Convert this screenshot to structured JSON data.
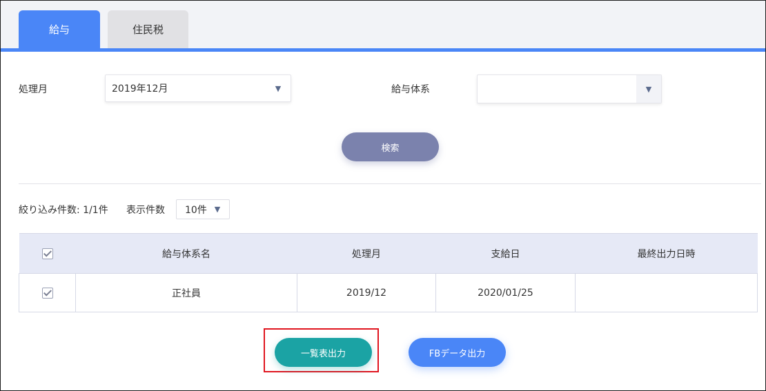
{
  "tabs": [
    {
      "label": "給与",
      "active": true
    },
    {
      "label": "住民税",
      "active": false
    }
  ],
  "filters": {
    "month_label": "処理月",
    "month_value": "2019年12月",
    "system_label": "給与体系",
    "system_value": ""
  },
  "search_label": "検索",
  "results": {
    "count_text": "絞り込み件数: 1/1件",
    "per_page_label": "表示件数",
    "per_page_value": "10件"
  },
  "table": {
    "headers": [
      "給与体系名",
      "処理月",
      "支給日",
      "最終出力日時"
    ],
    "rows": [
      {
        "checked": true,
        "name": "正社員",
        "month": "2019/12",
        "pay_date": "2020/01/25",
        "last_output": ""
      }
    ]
  },
  "actions": {
    "list_output": "一覧表出力",
    "fb_output": "FBデータ出力"
  },
  "colors": {
    "accent": "#4a86f7",
    "teal": "#1ba3a4",
    "search_button": "#7b82ad",
    "highlight": "#e0141e"
  }
}
